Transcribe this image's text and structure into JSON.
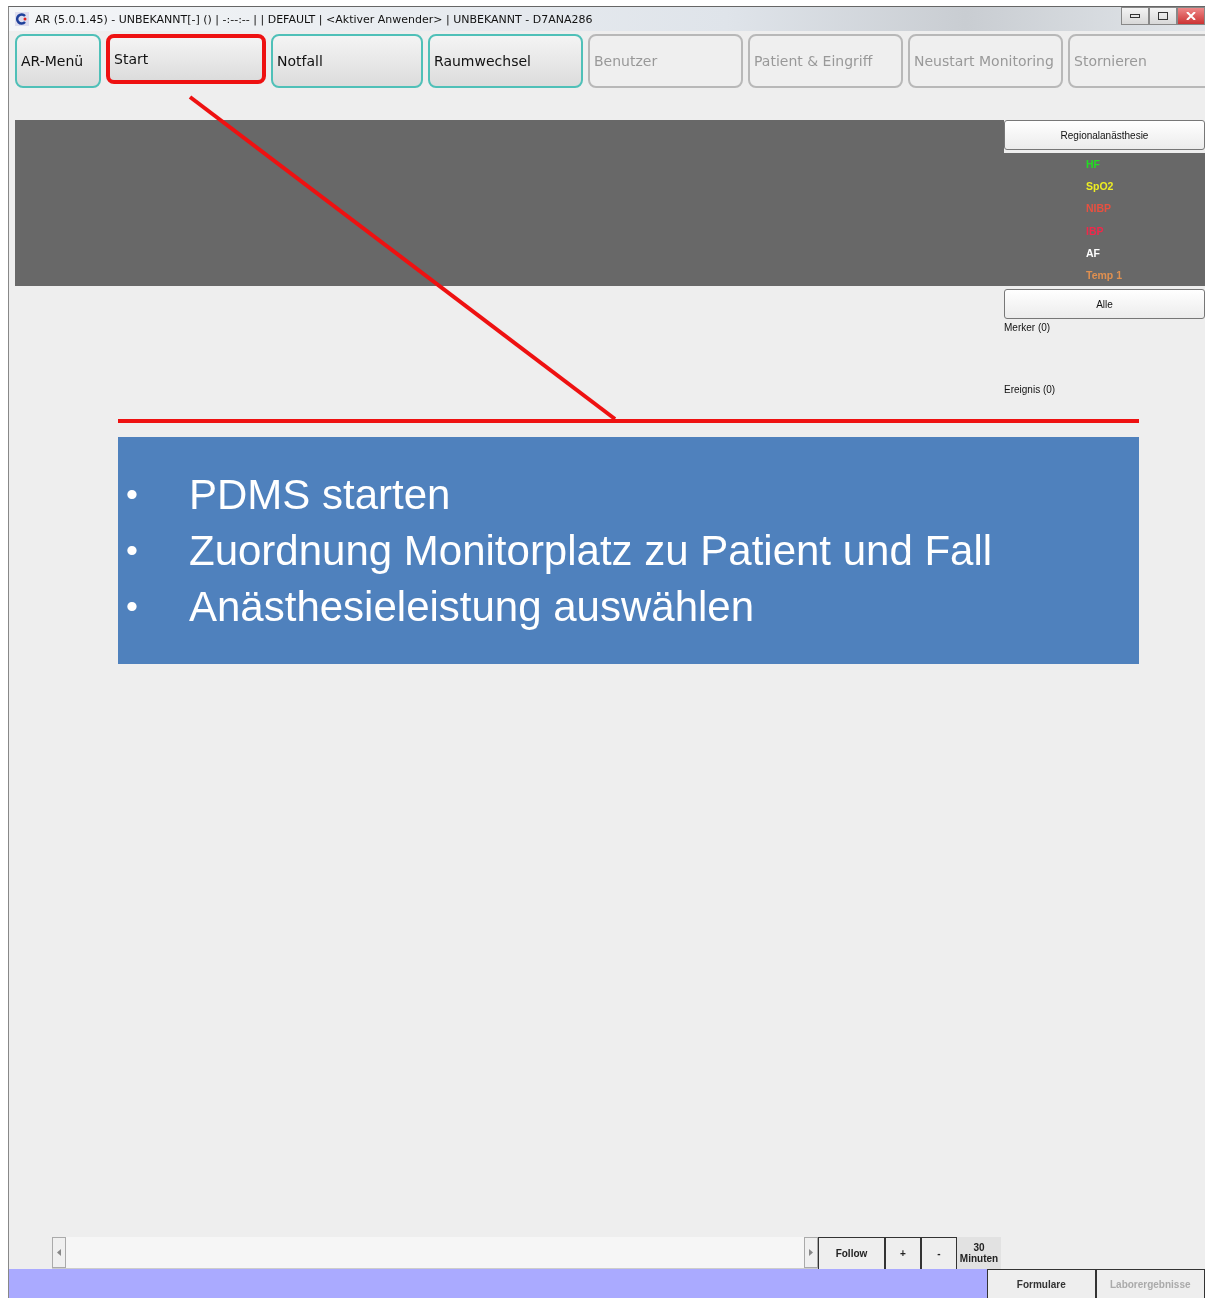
{
  "window": {
    "title": "AR (5.0.1.45) - UNBEKANNT[-] () | -:--:-- |  | DEFAULT | <Aktiver Anwender> | UNBEKANNT - D7ANA286"
  },
  "toolbar": [
    {
      "label": "AR-Menü",
      "disabled": false,
      "highlighted": false
    },
    {
      "label": "Start",
      "disabled": false,
      "highlighted": true
    },
    {
      "label": "Notfall",
      "disabled": false,
      "highlighted": false
    },
    {
      "label": "Raumwechsel",
      "disabled": false,
      "highlighted": false
    },
    {
      "label": "Benutzer",
      "disabled": true,
      "highlighted": false
    },
    {
      "label": "Patient & Eingriff",
      "disabled": true,
      "highlighted": false
    },
    {
      "label": "Neustart Monitoring",
      "disabled": true,
      "highlighted": false
    },
    {
      "label": "Stornieren",
      "disabled": true,
      "highlighted": false
    }
  ],
  "side_panel": {
    "mode_button": "Regionalanästhesie",
    "vitals": [
      {
        "label": "HF",
        "color": "#22dd22"
      },
      {
        "label": "SpO2",
        "color": "#eeee22"
      },
      {
        "label": "NIBP",
        "color": "#e85040"
      },
      {
        "label": "IBP",
        "color": "#f0284a"
      },
      {
        "label": "AF",
        "color": "#ffffff"
      },
      {
        "label": "Temp 1",
        "color": "#e09050"
      }
    ],
    "filter_button": "Alle",
    "markers": "Merker (0)",
    "events": "Ereignis (0)"
  },
  "timeline": {
    "buttons": [
      "Follow",
      "+",
      "-"
    ],
    "range_value": "30",
    "range_unit": "Minuten"
  },
  "bottom_tabs": [
    {
      "label": "Formulare",
      "disabled": false
    },
    {
      "label": "Laborergebnisse",
      "disabled": true
    }
  ],
  "callout": {
    "bullet": "•",
    "items": [
      "PDMS starten",
      "Zuordnung Monitorplatz zu Patient und Fall",
      "Anästhesieleistung auswählen"
    ]
  }
}
